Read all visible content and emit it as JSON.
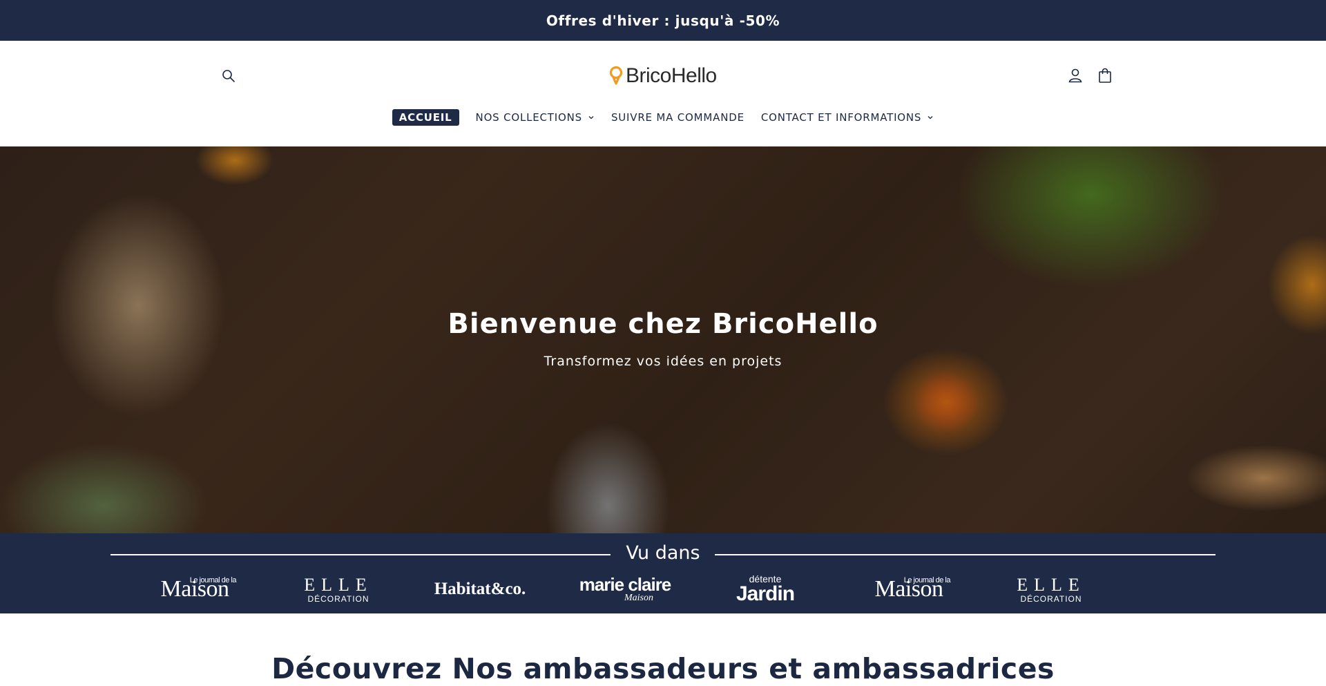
{
  "announcement": {
    "text": "Offres d'hiver : jusqu'à -50%"
  },
  "header": {
    "logo_text": "BricoHello",
    "icons": {
      "search": "search-icon",
      "account": "user-icon",
      "cart": "shopping-bag-icon",
      "logo": "lightbulb-icon"
    },
    "nav": [
      {
        "label": "ACCUEIL",
        "active": true,
        "has_dropdown": false
      },
      {
        "label": "NOS COLLECTIONS",
        "active": false,
        "has_dropdown": true
      },
      {
        "label": "SUIVRE MA COMMANDE",
        "active": false,
        "has_dropdown": false
      },
      {
        "label": "CONTACT ET INFORMATIONS",
        "active": false,
        "has_dropdown": true
      }
    ]
  },
  "hero": {
    "title": "Bienvenue chez BricoHello",
    "subtitle": "Transformez vos idées en projets"
  },
  "seen_in": {
    "title": "Vu dans",
    "brands": [
      {
        "name": "Maison",
        "small": "Le journal de la"
      },
      {
        "name": "ELLE",
        "small": "DÉCORATION"
      },
      {
        "name": "Habitat&co."
      },
      {
        "name": "marie claire",
        "small": "Maison"
      },
      {
        "name": "Jardin",
        "small": "détente"
      },
      {
        "name": "Maison",
        "small": "Le journal de la"
      },
      {
        "name": "ELLE",
        "small": "DÉCORATION"
      }
    ]
  },
  "section": {
    "title": "Découvrez Nos ambassadeurs et ambassadrices"
  },
  "colors": {
    "navy": "#1f2a47",
    "accent_orange": "#f29b1f",
    "white": "#ffffff"
  }
}
